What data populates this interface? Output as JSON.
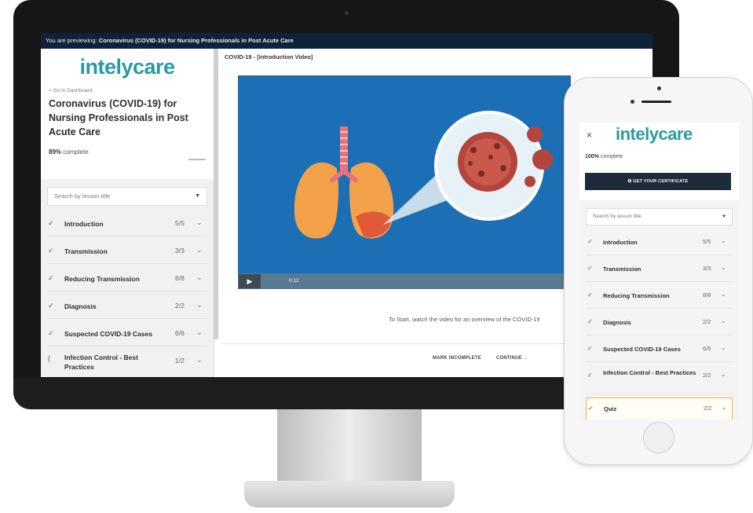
{
  "desktop": {
    "preview_prefix": "You are previewing:",
    "preview_course": "Coronavirus (COVID-19) for Nursing Professionals in Post Acute Care",
    "logo": "intelycare",
    "back_link": "< Go to Dashboard",
    "course_title": "Coronavirus (COVID-19) for Nursing Professionals in Post Acute Care",
    "progress_pct": "89%",
    "progress_word": "complete",
    "search_placeholder": "Search by lesson title",
    "lessons": [
      {
        "label": "Introduction",
        "count": "5/5",
        "status": "done"
      },
      {
        "label": "Transmission",
        "count": "3/3",
        "status": "done"
      },
      {
        "label": "Reducing Transmission",
        "count": "8/8",
        "status": "done"
      },
      {
        "label": "Diagnosis",
        "count": "2/2",
        "status": "done"
      },
      {
        "label": "Suspected COVID-19 Cases",
        "count": "6/6",
        "status": "done"
      },
      {
        "label": "Infection Control - Best Practices",
        "count": "1/2",
        "status": "in-progress"
      }
    ],
    "video_title": "COVID-19 - [Introduction Video]",
    "video_time": "0:12",
    "caption": "To Start, watch the video for an overview of the COVID-19",
    "mark_incomplete": "MARK INCOMPLETE",
    "continue": "CONTINUE →"
  },
  "mobile": {
    "logo": "intelycare",
    "close": "×",
    "progress_pct": "100%",
    "progress_word": "complete",
    "certificate_button": "GET YOUR CERTIFICATE",
    "search_placeholder": "Search by lesson title",
    "lessons": [
      {
        "label": "Introduction",
        "count": "5/5"
      },
      {
        "label": "Transmission",
        "count": "3/3"
      },
      {
        "label": "Reducing Transmission",
        "count": "8/8"
      },
      {
        "label": "Diagnosis",
        "count": "2/2"
      },
      {
        "label": "Suspected COVID-19 Cases",
        "count": "6/6"
      },
      {
        "label": "Infection Control - Best Practices",
        "count": "2/2"
      },
      {
        "label": "Quiz",
        "count": "2/2"
      }
    ]
  },
  "colors": {
    "brand_teal": "#2a9aa6",
    "preview_bar": "#0f2238",
    "video_bg": "#1d6fb5",
    "certificate_btn": "#1d2b3a",
    "active_outline": "#e6b84a"
  },
  "icons": [
    "check-icon",
    "chevron-down-icon",
    "play-icon",
    "close-icon",
    "certificate-icon",
    "loading-icon"
  ]
}
